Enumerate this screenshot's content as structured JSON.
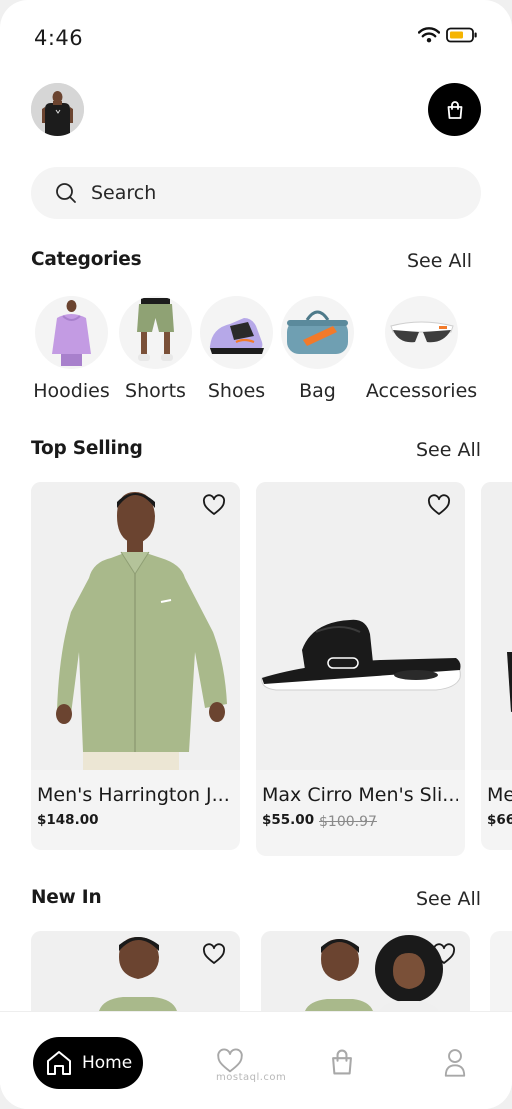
{
  "status_bar": {
    "time": "4:46"
  },
  "search": {
    "placeholder": "Search"
  },
  "categories": {
    "title": "Categories",
    "see_all": "See All",
    "items": [
      {
        "label": "Hoodies"
      },
      {
        "label": "Shorts"
      },
      {
        "label": "Shoes"
      },
      {
        "label": "Bag"
      },
      {
        "label": "Accessories"
      }
    ]
  },
  "top_selling": {
    "title": "Top Selling",
    "see_all": "See All",
    "products": [
      {
        "name": "Men's Harrington J...",
        "price": "$148.00",
        "old_price": ""
      },
      {
        "name": "Max Cirro Men's Sli...",
        "price": "$55.00",
        "old_price": "$100.97"
      },
      {
        "name": "Me",
        "price": "$66",
        "old_price": ""
      }
    ]
  },
  "new_in": {
    "title": "New In",
    "see_all": "See All"
  },
  "nav": {
    "home_label": "Home",
    "watermark": "mostaql.com"
  },
  "colors": {
    "primary": "#000000",
    "surface": "#f4f4f4",
    "battery": "#f5b400",
    "jacket": "#a9b98b",
    "hoodie": "#c39be3",
    "bag": "#6f9fb2",
    "accent_orange": "#f27a2a"
  },
  "icons": [
    "wifi-icon",
    "battery-icon",
    "bag-icon",
    "search-icon",
    "heart-icon",
    "home-icon",
    "user-icon"
  ]
}
